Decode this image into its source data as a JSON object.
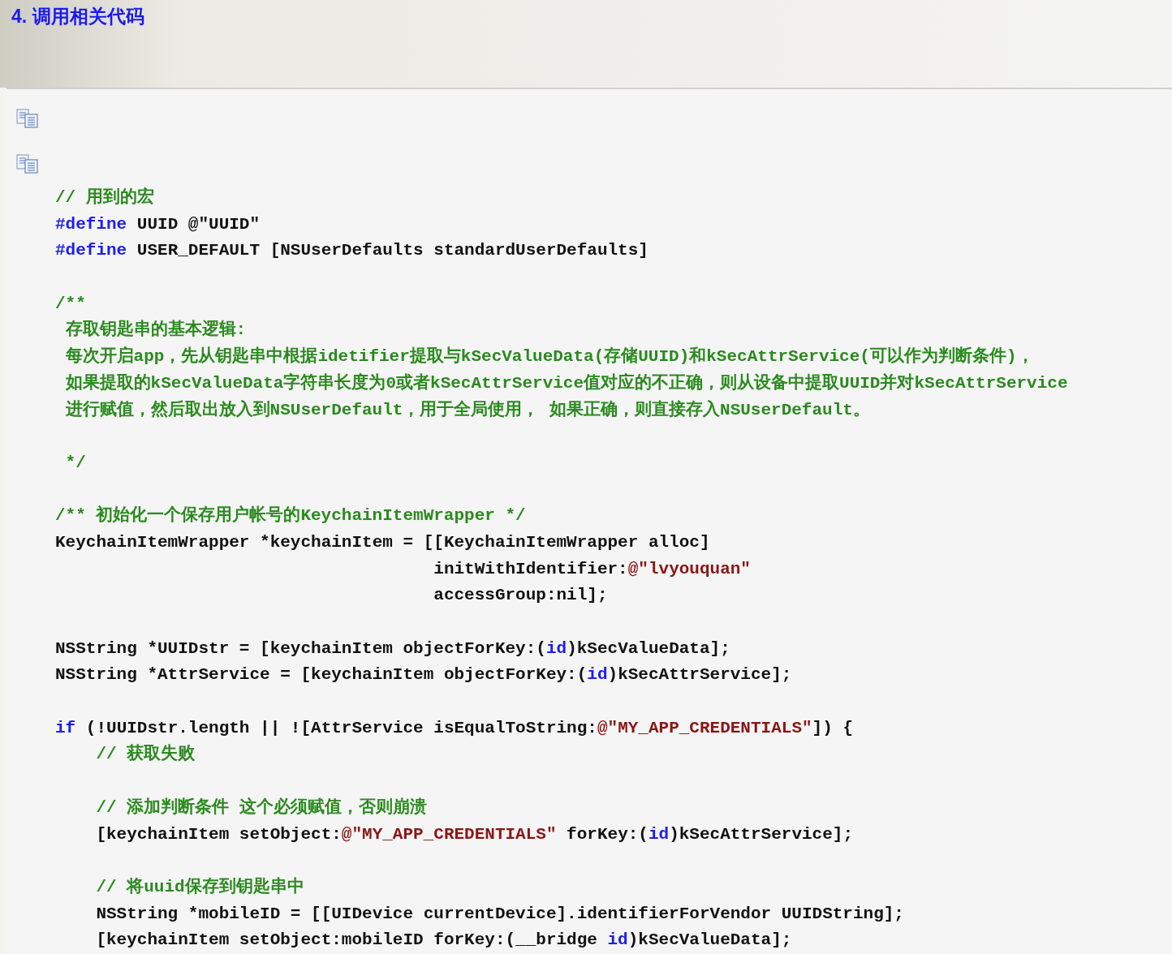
{
  "heading": "4. 调用相关代码",
  "code_lines": [
    {
      "kind": "code",
      "tokens": [
        {
          "kind": "comment",
          "text": "// 用到的宏"
        }
      ]
    },
    {
      "kind": "code",
      "tokens": [
        {
          "kind": "keyword",
          "text": "#define"
        },
        {
          "kind": "plain",
          "text": " UUID @\"UUID\""
        }
      ]
    },
    {
      "kind": "code",
      "tokens": [
        {
          "kind": "keyword",
          "text": "#define"
        },
        {
          "kind": "plain",
          "text": " USER_DEFAULT [NSUserDefaults standardUserDefaults]"
        }
      ]
    },
    {
      "kind": "blank"
    },
    {
      "kind": "code",
      "tokens": [
        {
          "kind": "comment",
          "text": "/**"
        }
      ]
    },
    {
      "kind": "code",
      "tokens": [
        {
          "kind": "comment",
          "text": " 存取钥匙串的基本逻辑:"
        }
      ]
    },
    {
      "kind": "code",
      "tokens": [
        {
          "kind": "comment",
          "text": " 每次开启app，先从钥匙串中根据idetifier提取与kSecValueData(存储UUID)和kSecAttrService(可以作为判断条件)，"
        }
      ]
    },
    {
      "kind": "code",
      "tokens": [
        {
          "kind": "comment",
          "text": " 如果提取的kSecValueData字符串长度为0或者kSecAttrService值对应的不正确，则从设备中提取UUID并对kSecAttrService"
        }
      ]
    },
    {
      "kind": "code",
      "tokens": [
        {
          "kind": "comment",
          "text": " 进行赋值，然后取出放入到NSUserDefault，用于全局使用， 如果正确，则直接存入NSUserDefault。"
        }
      ]
    },
    {
      "kind": "blank"
    },
    {
      "kind": "code",
      "tokens": [
        {
          "kind": "comment",
          "text": " */"
        }
      ]
    },
    {
      "kind": "blank"
    },
    {
      "kind": "code",
      "tokens": [
        {
          "kind": "comment",
          "text": "/** 初始化一个保存用户帐号的KeychainItemWrapper */"
        }
      ]
    },
    {
      "kind": "code",
      "tokens": [
        {
          "kind": "plain",
          "text": "KeychainItemWrapper *keychainItem = [[KeychainItemWrapper alloc]"
        }
      ]
    },
    {
      "kind": "code",
      "tokens": [
        {
          "kind": "plain",
          "text": "                                     initWithIdentifier:"
        },
        {
          "kind": "string",
          "text": "@\"lvyouquan\""
        }
      ]
    },
    {
      "kind": "code",
      "tokens": [
        {
          "kind": "plain",
          "text": "                                     accessGroup:nil];"
        }
      ]
    },
    {
      "kind": "blank"
    },
    {
      "kind": "code",
      "tokens": [
        {
          "kind": "plain",
          "text": "NSString *UUIDstr = [keychainItem objectForKey:("
        },
        {
          "kind": "keyword",
          "text": "id"
        },
        {
          "kind": "plain",
          "text": ")kSecValueData];"
        }
      ]
    },
    {
      "kind": "code",
      "tokens": [
        {
          "kind": "plain",
          "text": "NSString *AttrService = [keychainItem objectForKey:("
        },
        {
          "kind": "keyword",
          "text": "id"
        },
        {
          "kind": "plain",
          "text": ")kSecAttrService];"
        }
      ]
    },
    {
      "kind": "blank"
    },
    {
      "kind": "code",
      "tokens": [
        {
          "kind": "keyword",
          "text": "if"
        },
        {
          "kind": "plain",
          "text": " (!UUIDstr.length || ![AttrService isEqualToString:"
        },
        {
          "kind": "string",
          "text": "@\"MY_APP_CREDENTIALS\""
        },
        {
          "kind": "plain",
          "text": "]) {"
        }
      ]
    },
    {
      "kind": "code",
      "tokens": [
        {
          "kind": "comment",
          "text": "    // 获取失败"
        }
      ]
    },
    {
      "kind": "blank"
    },
    {
      "kind": "code",
      "tokens": [
        {
          "kind": "comment",
          "text": "    // 添加判断条件 这个必须赋值，否则崩溃"
        }
      ]
    },
    {
      "kind": "code",
      "tokens": [
        {
          "kind": "plain",
          "text": "    [keychainItem setObject:"
        },
        {
          "kind": "string",
          "text": "@\"MY_APP_CREDENTIALS\""
        },
        {
          "kind": "plain",
          "text": " forKey:("
        },
        {
          "kind": "keyword",
          "text": "id"
        },
        {
          "kind": "plain",
          "text": ")kSecAttrService];"
        }
      ]
    },
    {
      "kind": "blank"
    },
    {
      "kind": "code",
      "tokens": [
        {
          "kind": "comment",
          "text": "    // 将uuid保存到钥匙串中"
        }
      ]
    },
    {
      "kind": "code",
      "tokens": [
        {
          "kind": "plain",
          "text": "    NSString *mobileID = [[UIDevice currentDevice].identifierForVendor UUIDString];"
        }
      ]
    },
    {
      "kind": "code",
      "tokens": [
        {
          "kind": "plain",
          "text": "    [keychainItem setObject:mobileID forKey:(__bridge "
        },
        {
          "kind": "keyword",
          "text": "id"
        },
        {
          "kind": "plain",
          "text": ")kSecValueData];"
        }
      ]
    }
  ]
}
